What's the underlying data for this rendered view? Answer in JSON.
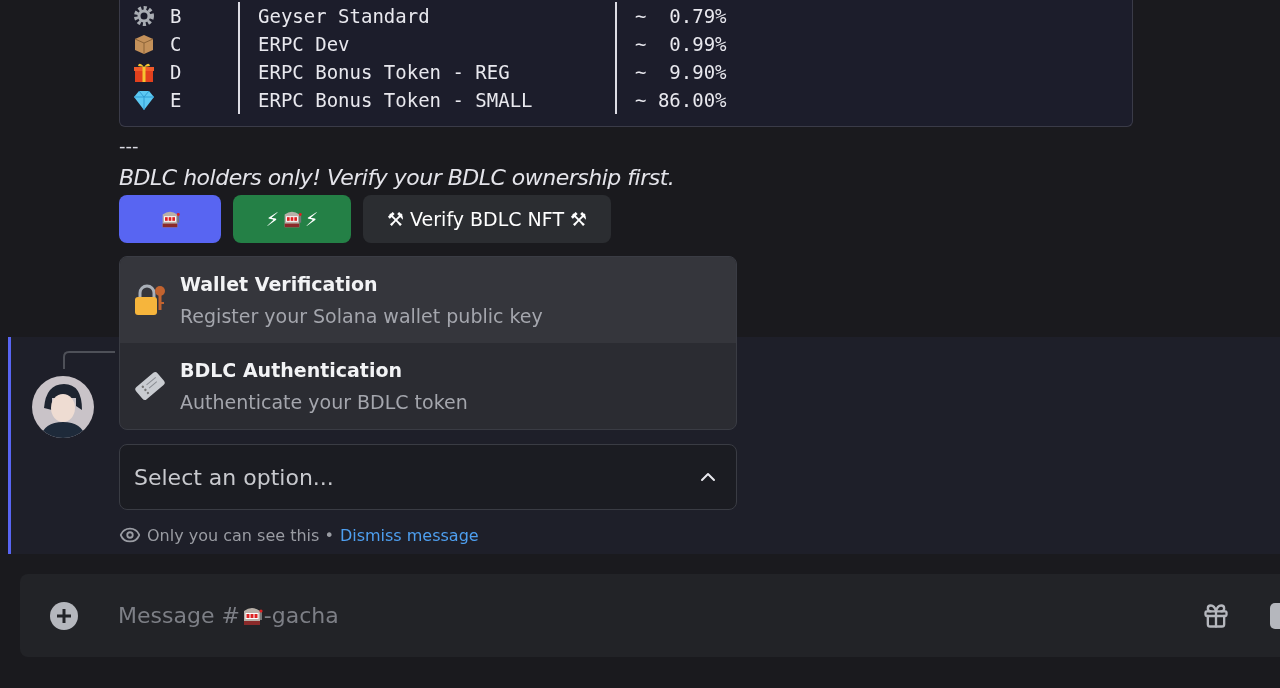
{
  "code_block": {
    "rows": [
      {
        "kind": "gear",
        "tier": "B",
        "name": "Geyser Standard",
        "chance": "~  0.79%"
      },
      {
        "kind": "box",
        "tier": "C",
        "name": "ERPC Dev",
        "chance": "~  0.99%"
      },
      {
        "kind": "gift",
        "tier": "D",
        "name": "ERPC Bonus Token - REG",
        "chance": "~  9.90%"
      },
      {
        "kind": "gem",
        "tier": "E",
        "name": "ERPC Bonus Token - SMALL",
        "chance": "~ 86.00%"
      }
    ]
  },
  "divider_text": "---",
  "notice": "BDLC holders only! Verify your BDLC ownership first.",
  "buttons": [
    {
      "kind": "slot"
    },
    {
      "kind": "bolt-slot",
      "bolt": "⚡"
    },
    {
      "kind": "text",
      "label": "⚒ Verify BDLC NFT ⚒"
    }
  ],
  "menu": {
    "options": [
      {
        "kind": "lock",
        "title": "Wallet Verification",
        "description": "Register your Solana wallet public key",
        "selected": true
      },
      {
        "kind": "ticket",
        "title": "BDLC Authentication",
        "description": "Authenticate your BDLC token",
        "selected": false
      }
    ]
  },
  "select": {
    "placeholder": "Select an option...",
    "expanded": true
  },
  "ephemeral": {
    "note": "Only you can see this •",
    "dismiss": "Dismiss message"
  },
  "composer": {
    "placeholder_prefix": "Message #",
    "channel": "-gacha"
  }
}
